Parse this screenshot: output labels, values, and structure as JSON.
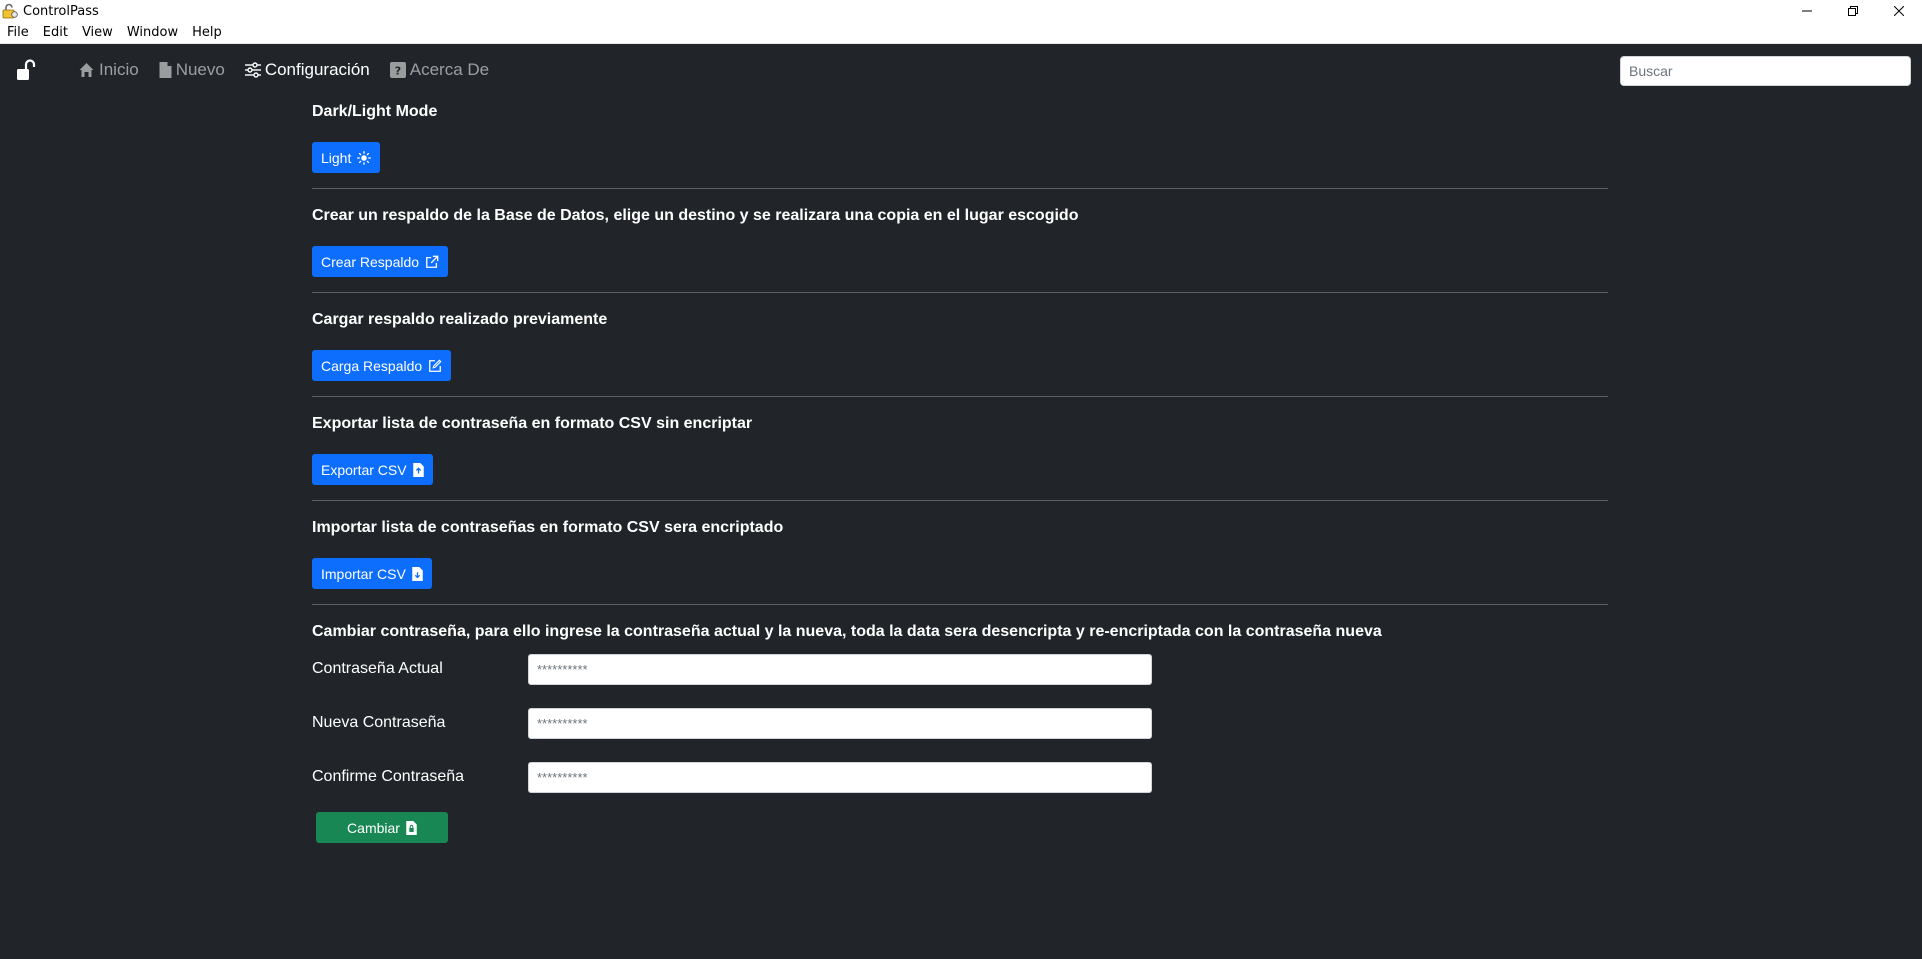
{
  "window": {
    "title": "ControlPass",
    "controls": [
      "minimize",
      "restore",
      "close"
    ]
  },
  "menu": {
    "items": [
      "File",
      "Edit",
      "View",
      "Window",
      "Help"
    ]
  },
  "nav": {
    "brand_icon": "unlock-icon",
    "links": [
      {
        "label": "Inicio",
        "icon": "house-icon",
        "active": false
      },
      {
        "label": "Nuevo",
        "icon": "file-icon",
        "active": false
      },
      {
        "label": "Configuración",
        "icon": "sliders-icon",
        "active": true
      },
      {
        "label": "Acerca De",
        "icon": "question-square-icon",
        "active": false
      }
    ],
    "search_placeholder": "Buscar"
  },
  "sections": {
    "theme": {
      "title": "Dark/Light Mode",
      "button": "Light",
      "icon": "sun-icon"
    },
    "backup": {
      "title": "Crear un respaldo de la Base de Datos, elige un destino y se realizara una copia en el lugar escogido",
      "button": "Crear Respaldo",
      "icon": "box-arrow-up-right-icon"
    },
    "restore": {
      "title": "Cargar respaldo realizado previamente",
      "button": "Carga Respaldo",
      "icon": "pencil-square-icon"
    },
    "export": {
      "title": "Exportar lista de contraseña en formato CSV sin encriptar",
      "button": "Exportar CSV",
      "icon": "file-export-icon"
    },
    "import": {
      "title": "Importar lista de contraseñas en formato CSV sera encriptado",
      "button": "Importar CSV",
      "icon": "file-import-icon"
    },
    "password": {
      "title": "Cambiar contraseña, para ello ingrese la contraseña actual y la nueva, toda la data sera desencripta y re-encriptada con la contraseña nueva",
      "fields": [
        {
          "label": "Contraseña Actual",
          "placeholder": "**********"
        },
        {
          "label": "Nueva Contraseña",
          "placeholder": "**********"
        },
        {
          "label": "Confirme Contraseña",
          "placeholder": "**********"
        }
      ],
      "button": "Cambiar",
      "icon": "file-lock-icon"
    }
  },
  "colors": {
    "background": "#212529",
    "primary": "#0d6efd",
    "success": "#198754"
  }
}
